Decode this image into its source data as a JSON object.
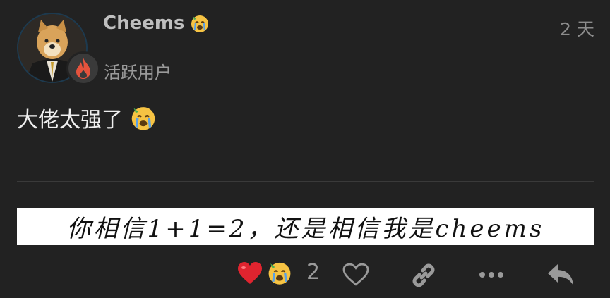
{
  "post": {
    "username": "Cheems",
    "user_title": "活跃用户",
    "date": "2 天",
    "body_text": "大佬太强了",
    "image_text": "你相信1+1=2，还是相信我是cheems"
  },
  "actions": {
    "reaction_count": "2",
    "icons": [
      "heart-emoji",
      "crying-emoji",
      "like-icon",
      "link-icon",
      "more-icon",
      "reply-icon"
    ]
  },
  "colors": {
    "background": "#222222",
    "username": "#bfbfbf",
    "muted": "#8c8c8c",
    "flair_flame": "#e5533d"
  }
}
